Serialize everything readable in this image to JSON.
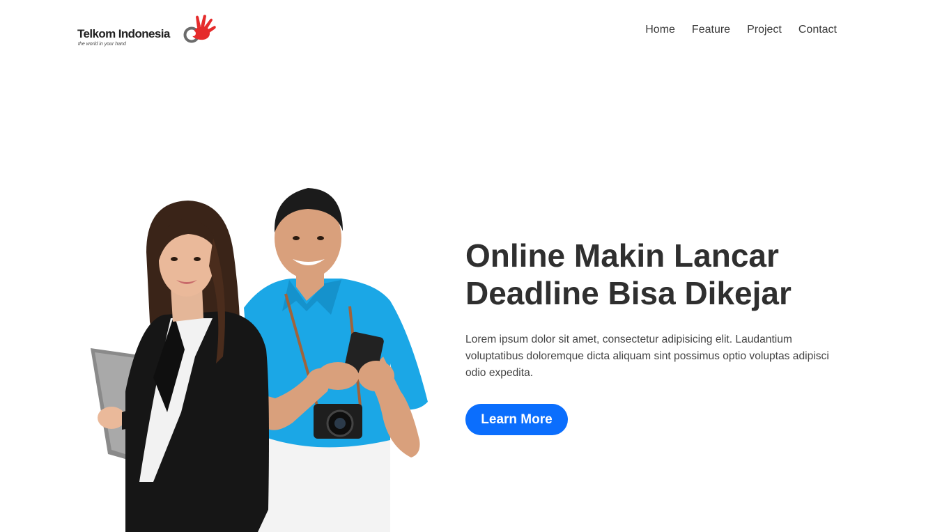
{
  "brand": {
    "name": "Telkom Indonesia",
    "tagline": "the world in your hand",
    "logo_icon": "telkom-hand-logo",
    "accent": "#e52b2b"
  },
  "nav": {
    "items": [
      {
        "label": "Home"
      },
      {
        "label": "Feature"
      },
      {
        "label": "Project"
      },
      {
        "label": "Contact"
      }
    ]
  },
  "hero": {
    "title_line1": "Online Makin Lancar",
    "title_line2": "Deadline Bisa Dikejar",
    "description": "Lorem ipsum dolor sit amet, consectetur adipisicing elit. Laudantium voluptatibus doloremque dicta aliquam sint possimus optio voluptas adipisci odio expedita.",
    "cta_label": "Learn More",
    "cta_color": "#0b6efd",
    "image_subject": "woman-and-man-illustration"
  }
}
